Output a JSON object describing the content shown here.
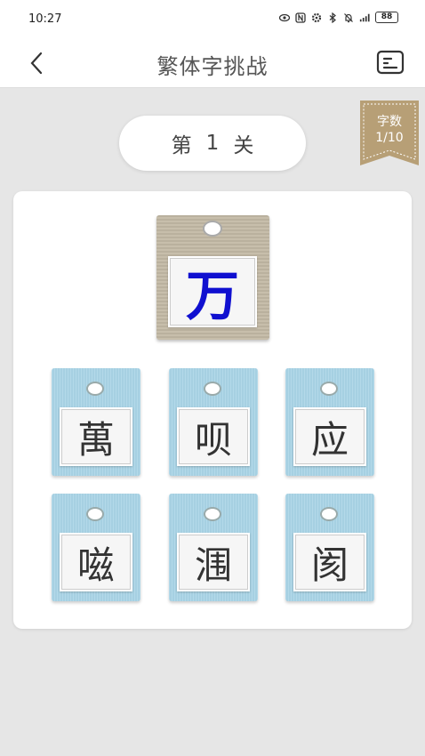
{
  "status": {
    "time": "10:27",
    "battery": "88"
  },
  "header": {
    "title": "繁体字挑战"
  },
  "level": {
    "prefix": "第",
    "number": "1",
    "suffix": "关"
  },
  "ribbon": {
    "label": "字数",
    "progress": "1/10"
  },
  "question": {
    "char": "万"
  },
  "options": [
    "萬",
    "呗",
    "应",
    "嗞",
    "涠",
    "阂"
  ],
  "colors": {
    "question_tag": "#c2b8a4",
    "option_tag": "#a9d4e6",
    "question_char": "#1010d0",
    "ribbon": "#b79f76"
  }
}
